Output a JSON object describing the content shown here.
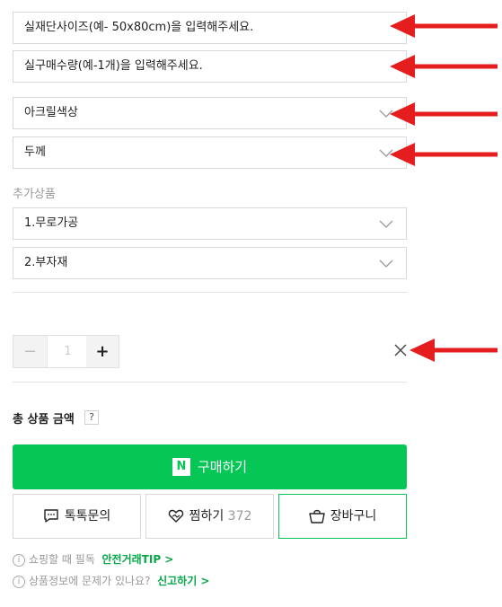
{
  "inputs": {
    "size_placeholder": "실재단사이즈(예- 50x80cm)을 입력해주세요.",
    "qty_placeholder": "실구매수량(예-1개)을 입력해주세요."
  },
  "selects": {
    "acrylic_color": "아크릴색상",
    "thickness": "두께"
  },
  "additional": {
    "label": "추가상품",
    "option1": "1.무로가공",
    "option2": "2.부자재"
  },
  "quantity": {
    "minus": "−",
    "value": "1",
    "plus": "+"
  },
  "total": {
    "label": "총 상품 금액",
    "help": "?"
  },
  "actions": {
    "buy_logo": "N",
    "buy_label": "구매하기",
    "talk_label": "톡톡문의",
    "wish_label": "찜하기",
    "wish_count": "372",
    "cart_label": "장바구니"
  },
  "notices": {
    "n1_text": "쇼핑할 때 필독",
    "n1_link": "안전거래TIP >",
    "n2_text": "상품정보에 문제가 있나요?",
    "n2_link": "신고하기 >",
    "info_glyph": "i"
  },
  "annotation_color": "#e41e1e",
  "accent_green": "#06c755"
}
